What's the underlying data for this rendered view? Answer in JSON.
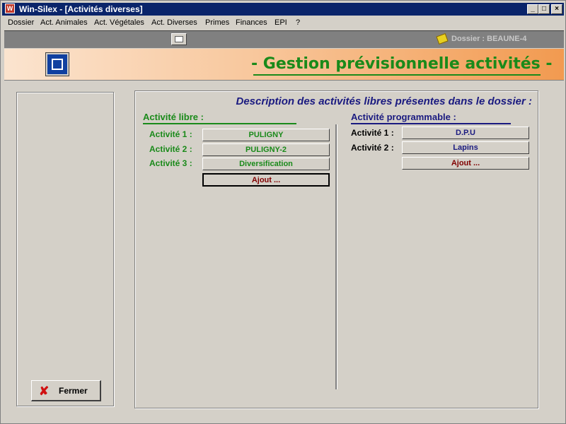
{
  "window": {
    "title": "Win-Silex - [Activités diverses]",
    "app_icon": "win-silex-icon",
    "controls": {
      "minimize": "_",
      "maximize": "□",
      "close": "×"
    }
  },
  "menu": [
    "Dossier",
    "Act. Animales",
    "Act. Végétales",
    "Act. Diverses",
    "Primes",
    "Finances",
    "EPI",
    "?"
  ],
  "toolbar": {
    "icon": "calendar-icon",
    "dossier_label": "Dossier : BEAUNE-4",
    "dossier_icon": "pencil-icon"
  },
  "banner": {
    "icon": "navigation-icon",
    "title": "- Gestion prévisionnelle activités -"
  },
  "description": "Description des activités libres présentes dans  le dossier :",
  "libre": {
    "heading": "Activité libre :",
    "rows": [
      {
        "label": "Activité 1 :",
        "value": "PULIGNY"
      },
      {
        "label": "Activité 2 :",
        "value": "PULIGNY-2"
      },
      {
        "label": "Activité 3 :",
        "value": "Diversification"
      }
    ],
    "add_label": "Ajout ..."
  },
  "programmable": {
    "heading": "Activité programmable :",
    "rows": [
      {
        "label": "Activité 1 :",
        "value": "D.P.U"
      },
      {
        "label": "Activité 2 :",
        "value": "Lapins"
      }
    ],
    "add_label": "Ajout ..."
  },
  "close_button": "Fermer",
  "colors": {
    "green": "#1a8a1a",
    "navy": "#1a1a80",
    "maroon": "#800000",
    "title_bar": "#0a246a"
  }
}
